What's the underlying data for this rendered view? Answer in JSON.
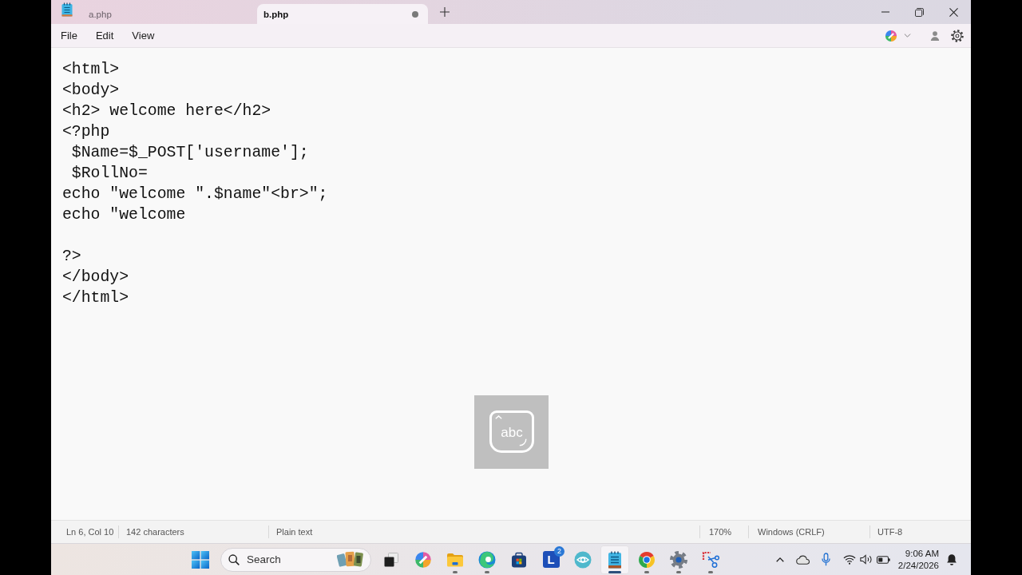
{
  "tabs": [
    {
      "label": "a.php",
      "selected": false,
      "unsaved": false
    },
    {
      "label": "b.php",
      "selected": true,
      "unsaved": true
    }
  ],
  "menu": [
    "File",
    "Edit",
    "View"
  ],
  "editor": {
    "lines": [
      {
        "kind": "code",
        "text": "<html>"
      },
      {
        "kind": "code",
        "text": "<body>"
      },
      {
        "kind": "code",
        "text": "<h2> welcome here</h2>"
      },
      {
        "kind": "code",
        "text": "<?php"
      },
      {
        "kind": "code",
        "text": " $Name=$_POST['username'];"
      },
      {
        "kind": "code",
        "text": " $RollNo="
      },
      {
        "kind": "code",
        "text": "echo \"welcome \".$name\"<br>\";"
      },
      {
        "kind": "code",
        "text": "echo \"welcome"
      },
      {
        "kind": "blank"
      },
      {
        "kind": "code",
        "text": "?>"
      },
      {
        "kind": "code",
        "text": "</body>"
      },
      {
        "kind": "code",
        "text": "</html>"
      }
    ]
  },
  "input_indicator": {
    "label": "abc"
  },
  "status_bar": [
    "Ln 6, Col 10",
    "142 characters",
    "Plain text",
    "170%",
    "Windows (CRLF)",
    "UTF-8"
  ],
  "taskbar": {
    "search": {
      "placeholder": "Search"
    },
    "apps": [
      {
        "kind": "taskview",
        "running": false,
        "selected": false
      },
      {
        "kind": "swirl",
        "running": false,
        "selected": false
      },
      {
        "kind": "folder",
        "running": true,
        "selected": false
      },
      {
        "kind": "wave",
        "running": true,
        "selected": false
      },
      {
        "kind": "store",
        "running": false,
        "selected": false
      },
      {
        "kind": "letter",
        "label": "L",
        "badge": "2",
        "running": false,
        "selected": false
      },
      {
        "kind": "eye",
        "running": false,
        "selected": false
      },
      {
        "kind": "notepad",
        "running": true,
        "selected": true
      },
      {
        "kind": "segments",
        "running": true,
        "selected": false
      },
      {
        "kind": "gear",
        "running": true,
        "selected": false
      },
      {
        "kind": "scissors",
        "running": true,
        "selected": false
      }
    ],
    "clock": {
      "time": "9:06 AM",
      "date": "2/24/2026"
    }
  }
}
